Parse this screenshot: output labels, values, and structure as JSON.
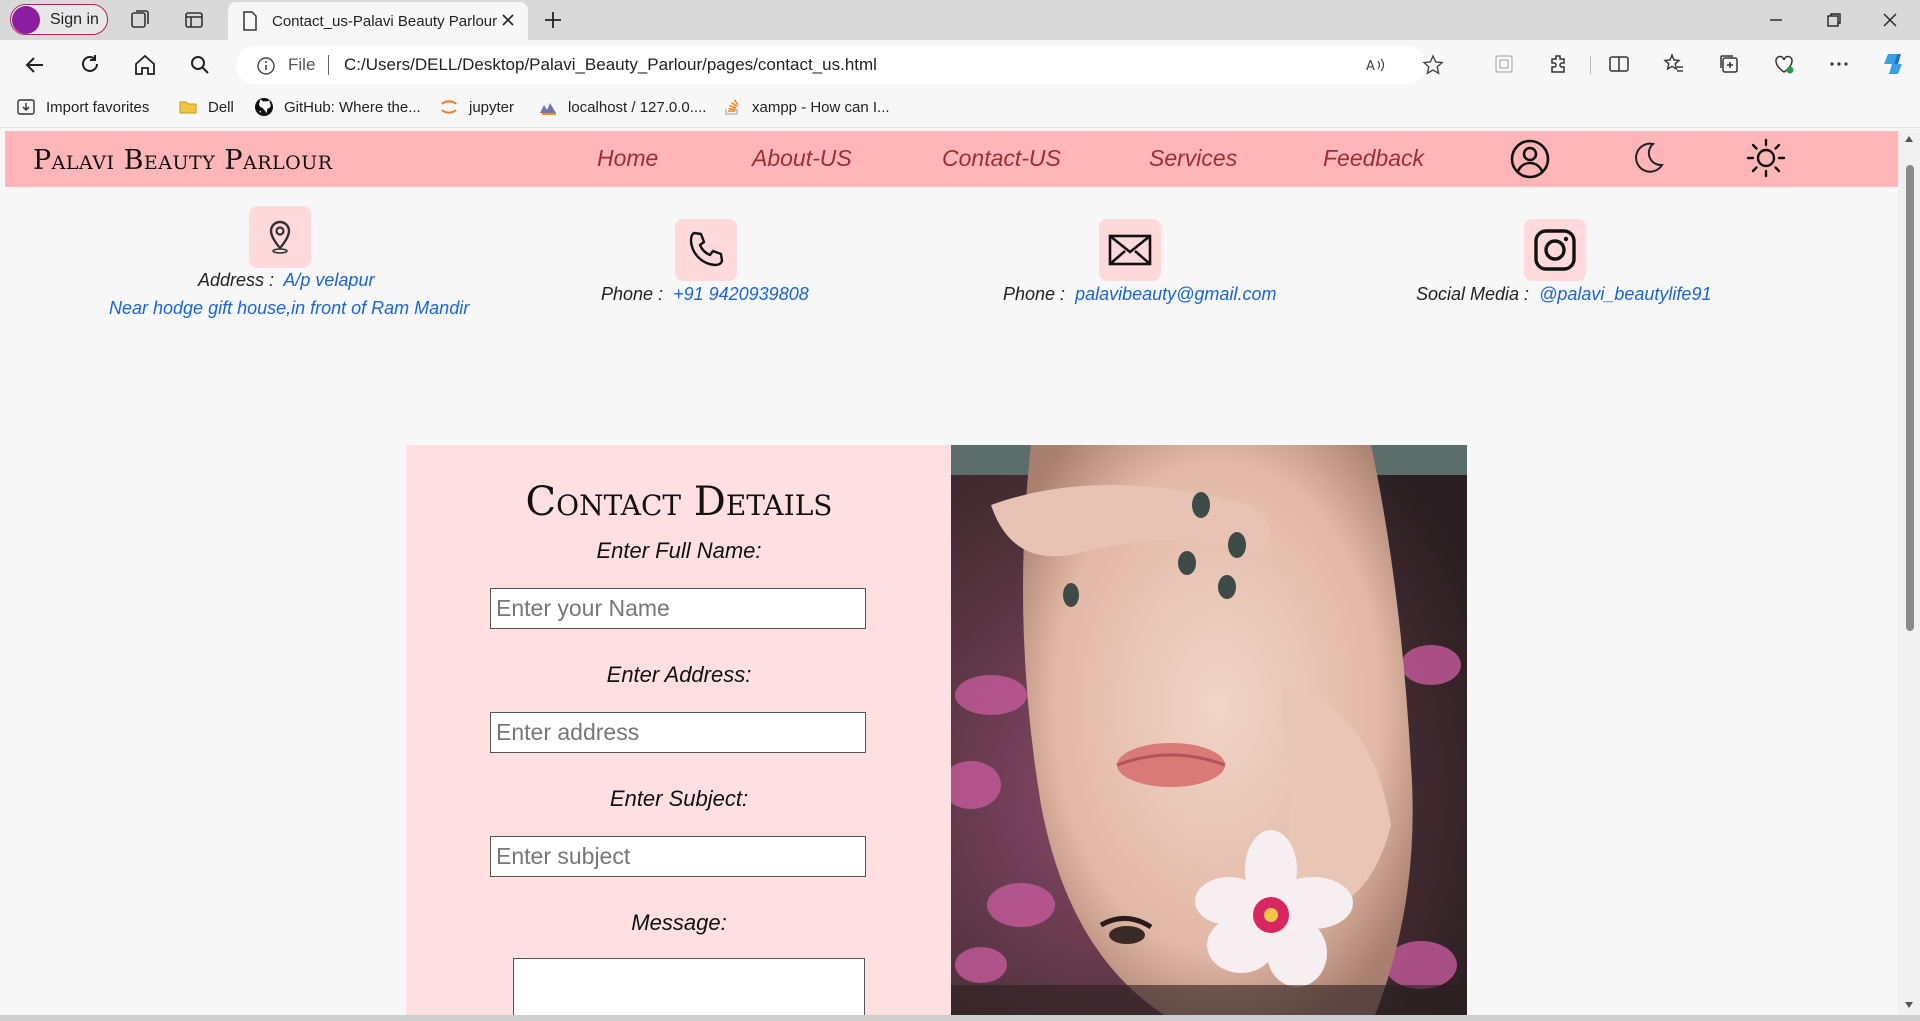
{
  "browser": {
    "signin_label": "Sign in",
    "tab_title": "Contact_us-Palavi Beauty Parlour",
    "url_scheme": "File",
    "url": "C:/Users/DELL/Desktop/Palavi_Beauty_Parlour/pages/contact_us.html",
    "favorites": [
      {
        "label": "Import favorites",
        "icon": "import-icon"
      },
      {
        "label": "Dell",
        "icon": "folder-icon"
      },
      {
        "label": "GitHub: Where the...",
        "icon": "github-icon"
      },
      {
        "label": "jupyter",
        "icon": "jupyter-icon"
      },
      {
        "label": "localhost / 127.0.0....",
        "icon": "phpmyadmin-icon"
      },
      {
        "label": "xampp - How can I...",
        "icon": "stackoverflow-icon"
      }
    ]
  },
  "site": {
    "brand": "Palavi Beauty Parlour",
    "nav": [
      "Home",
      "About-US",
      "Contact-US",
      "Services",
      "Feedback"
    ],
    "nav_icons": [
      "user-circle-icon",
      "moon-icon",
      "sun-icon"
    ],
    "colors": {
      "header_bg": "#ffb6b9",
      "nav_text": "#9d2e36",
      "link": "#1a65d6",
      "panel_bg": "#ffe0e2"
    }
  },
  "contact_info": {
    "address": {
      "label": "Address :",
      "line1": "A/p velapur",
      "line2": "Near hodge gift house,in front of Ram Mandir",
      "icon": "location-pin-icon"
    },
    "phone": {
      "label": "Phone :",
      "value": "+91 9420939808",
      "icon": "phone-icon"
    },
    "email": {
      "label": "Phone :",
      "value": "palavibeauty@gmail.com",
      "icon": "mail-icon"
    },
    "social": {
      "label": "Social Media :",
      "value": "@palavi_beautylife91",
      "icon": "instagram-icon"
    }
  },
  "form": {
    "title": "Contact Details",
    "name_label": "Enter Full Name:",
    "name_placeholder": "Enter your Name",
    "address_label": "Enter Address:",
    "address_placeholder": "Enter address",
    "subject_label": "Enter Subject:",
    "subject_placeholder": "Enter subject",
    "message_label": "Message:"
  }
}
